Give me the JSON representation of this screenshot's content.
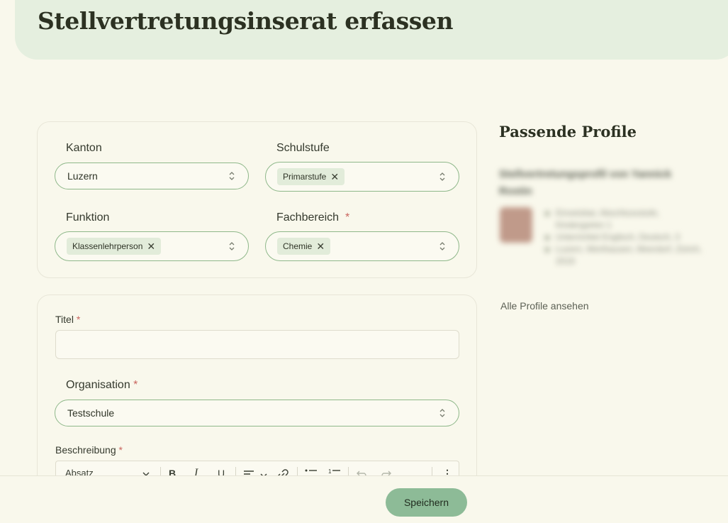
{
  "page": {
    "title": "Stellvertretungsinserat erfassen"
  },
  "filters": {
    "kanton": {
      "label": "Kanton",
      "value": "Luzern"
    },
    "schulstufe": {
      "label": "Schulstufe",
      "chip": "Primarstufe"
    },
    "funktion": {
      "label": "Funktion",
      "chip": "Klassenlehrperson"
    },
    "fachbereich": {
      "label": "Fachbereich",
      "required_mark": "*",
      "chip": "Chemie"
    }
  },
  "form": {
    "titel": {
      "label": "Titel",
      "required_mark": "*",
      "value": ""
    },
    "organisation": {
      "label": "Organisation",
      "required_mark": "*",
      "value": "Testschule"
    },
    "beschreibung": {
      "label": "Beschreibung",
      "required_mark": "*"
    },
    "toolbar": {
      "block_format": "Absatz",
      "bold": "B",
      "italic": "I",
      "underline": "U",
      "more": "⋮"
    }
  },
  "sidebar": {
    "title": "Passende Profile",
    "profile": {
      "name": "Stellvertretungsprofil von Yannick Rostin",
      "lines": [
        "Einsetzbar, Abschlussstufe, Kindergarten 1",
        "Unterrichtet Englisch, Deutsch, 3",
        "Luzern, Werthausen, Meerdorf, Zürich, 2019"
      ]
    },
    "all_profiles_link": "Alle Profile ansehen"
  },
  "footer": {
    "save_label": "Speichern"
  },
  "colors": {
    "accent": "#8dbb97",
    "header_bg": "#e5efdf",
    "page_bg": "#f9f8ec",
    "required": "#c9655e"
  }
}
